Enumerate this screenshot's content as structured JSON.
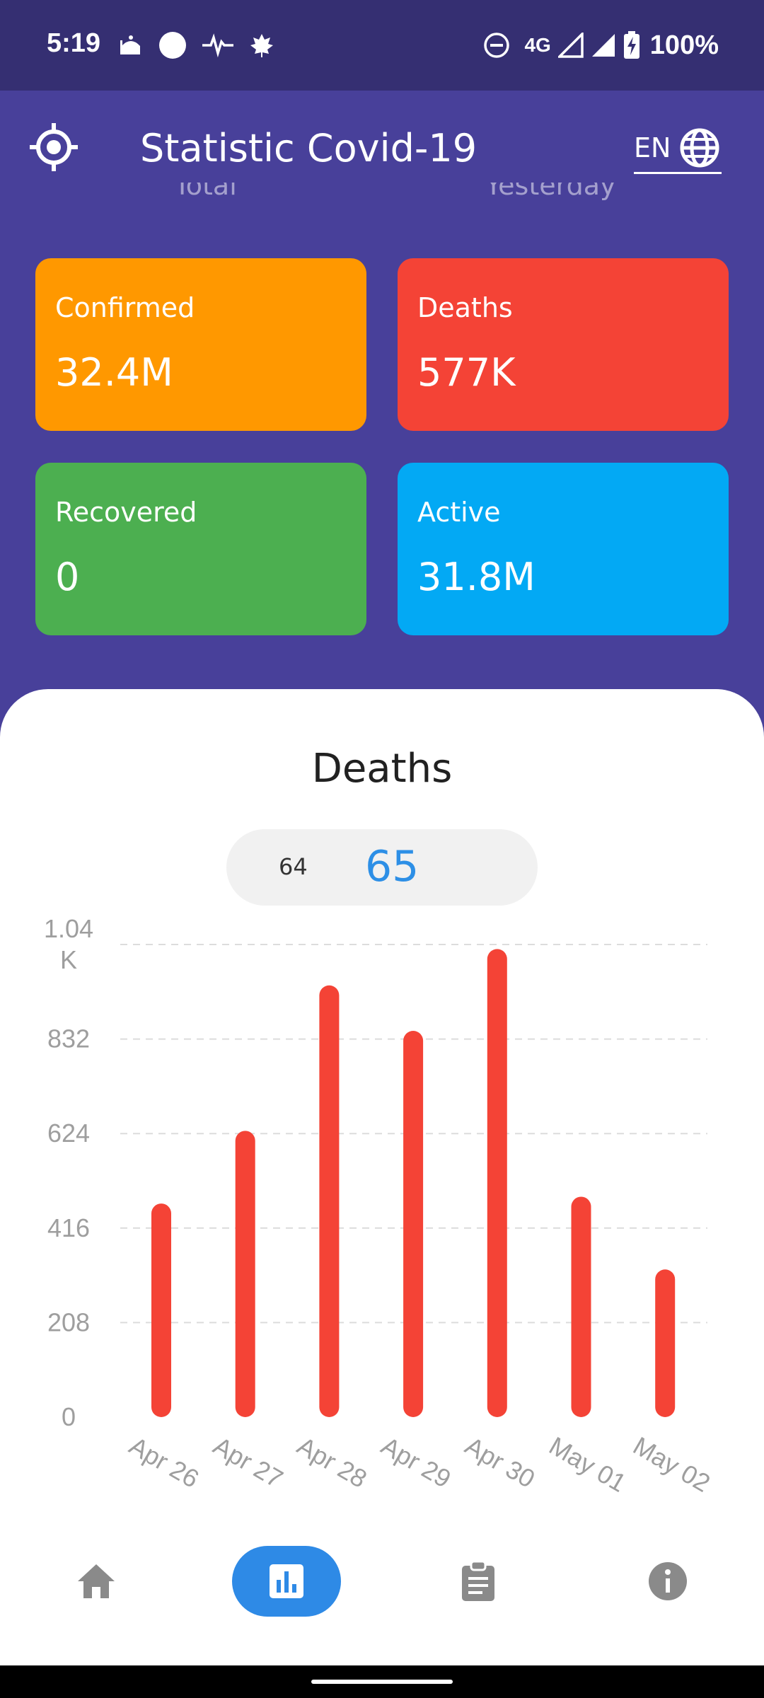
{
  "status_bar": {
    "time": "5:19",
    "network": "4G",
    "battery": "100%"
  },
  "app_bar": {
    "title": "Statistic Covid-19",
    "language": "EN"
  },
  "tabs": [
    "Total",
    "Yesterday"
  ],
  "stats": {
    "confirmed": {
      "label": "Confirmed",
      "value": "32.4M",
      "color": "#ff9800"
    },
    "deaths": {
      "label": "Deaths",
      "value": "577K",
      "color": "#f44336"
    },
    "recovered": {
      "label": "Recovered",
      "value": "0",
      "color": "#4caf50"
    },
    "active": {
      "label": "Active",
      "value": "31.8M",
      "color": "#03a9f4"
    }
  },
  "chart_section": {
    "title": "Deaths",
    "selector_prev": "64",
    "selector_current": "65"
  },
  "chart_data": {
    "type": "bar",
    "categories": [
      "Apr 26",
      "Apr 27",
      "Apr 28",
      "Apr 29",
      "Apr 30",
      "May 01",
      "May 02"
    ],
    "values": [
      470,
      630,
      950,
      850,
      1030,
      485,
      325
    ],
    "ylim": [
      0,
      1040
    ],
    "yticks": [
      0,
      208,
      416,
      624,
      832,
      1040
    ],
    "ytick_labels": [
      "0",
      "208",
      "416",
      "624",
      "832",
      "1.04\nK"
    ],
    "grid": true,
    "bar_color": "#f44336"
  },
  "bottom_nav": {
    "items": [
      {
        "icon": "home-icon",
        "active": false
      },
      {
        "icon": "bar-chart-icon",
        "active": true
      },
      {
        "icon": "clipboard-icon",
        "active": false
      },
      {
        "icon": "info-icon",
        "active": false
      }
    ]
  }
}
